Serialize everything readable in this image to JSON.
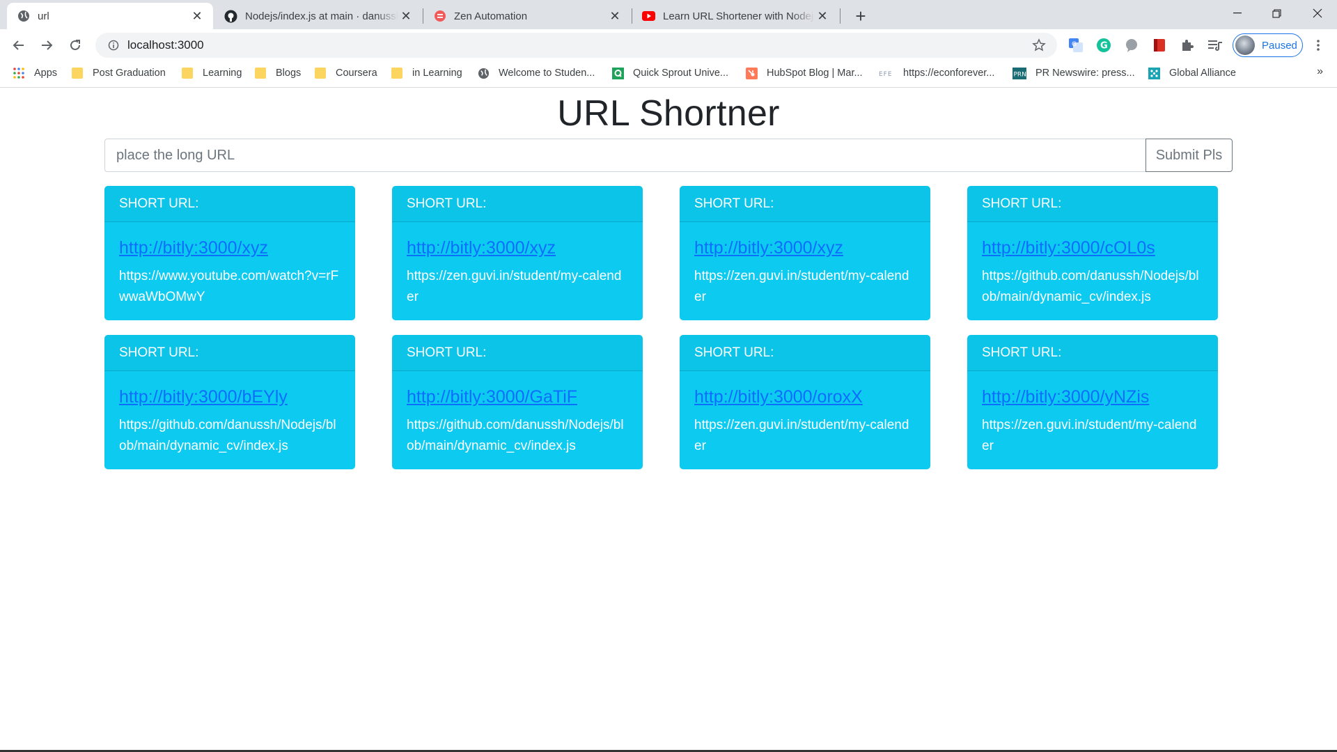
{
  "browser": {
    "tabs": [
      {
        "title": "url",
        "icon": "globe-icon"
      },
      {
        "title": "Nodejs/index.js at main · danussh/Nodejs",
        "icon": "github-icon"
      },
      {
        "title": "Zen Automation",
        "icon": "zen-icon"
      },
      {
        "title": "Learn URL Shortener with Nodejs",
        "icon": "youtube-icon"
      }
    ],
    "address": "localhost:3000",
    "profile_label": "Paused",
    "bookmarks": [
      {
        "label": "Apps",
        "icon": "apps-icon"
      },
      {
        "label": "Post Graduation",
        "icon": "folder-icon"
      },
      {
        "label": "Learning",
        "icon": "folder-icon"
      },
      {
        "label": "Blogs",
        "icon": "folder-icon"
      },
      {
        "label": "Coursera",
        "icon": "folder-icon"
      },
      {
        "label": "in Learning",
        "icon": "folder-icon"
      },
      {
        "label": "Welcome to Studen...",
        "icon": "globe-icon"
      },
      {
        "label": "Quick Sprout Unive...",
        "icon": "quicksprout-icon"
      },
      {
        "label": "HubSpot Blog | Mar...",
        "icon": "hubspot-icon"
      },
      {
        "label": "https://econforever...",
        "icon": "efe-icon"
      },
      {
        "label": "PR Newswire: press...",
        "icon": "prn-icon"
      },
      {
        "label": "Global Alliance",
        "icon": "global-alliance-icon"
      }
    ],
    "more_label": "»"
  },
  "page": {
    "title": "URL Shortner",
    "input_placeholder": "place the long URL",
    "submit_label": "Submit Pls",
    "card_header": "SHORT URL:",
    "cards": [
      {
        "short": "http://bitly:3000/xyz",
        "long": "https://www.youtube.com/watch?v=rFwwaWbOMwY"
      },
      {
        "short": "http://bitly:3000/xyz",
        "long": "https://zen.guvi.in/student/my-calender"
      },
      {
        "short": "http://bitly:3000/xyz",
        "long": "https://zen.guvi.in/student/my-calender"
      },
      {
        "short": "http://bitly:3000/cOL0s",
        "long": "https://github.com/danussh/Nodejs/blob/main/dynamic_cv/index.js"
      },
      {
        "short": "http://bitly:3000/bEYly",
        "long": "https://github.com/danussh/Nodejs/blob/main/dynamic_cv/index.js"
      },
      {
        "short": "http://bitly:3000/GaTiF",
        "long": "https://github.com/danussh/Nodejs/blob/main/dynamic_cv/index.js"
      },
      {
        "short": "http://bitly:3000/oroxX",
        "long": "https://zen.guvi.in/student/my-calender"
      },
      {
        "short": "http://bitly:3000/yNZis",
        "long": "https://zen.guvi.in/student/my-calender"
      }
    ]
  },
  "colors": {
    "card_bg": "#0dcaf0",
    "link": "#0d6efd",
    "accent": "#1a73e8"
  }
}
